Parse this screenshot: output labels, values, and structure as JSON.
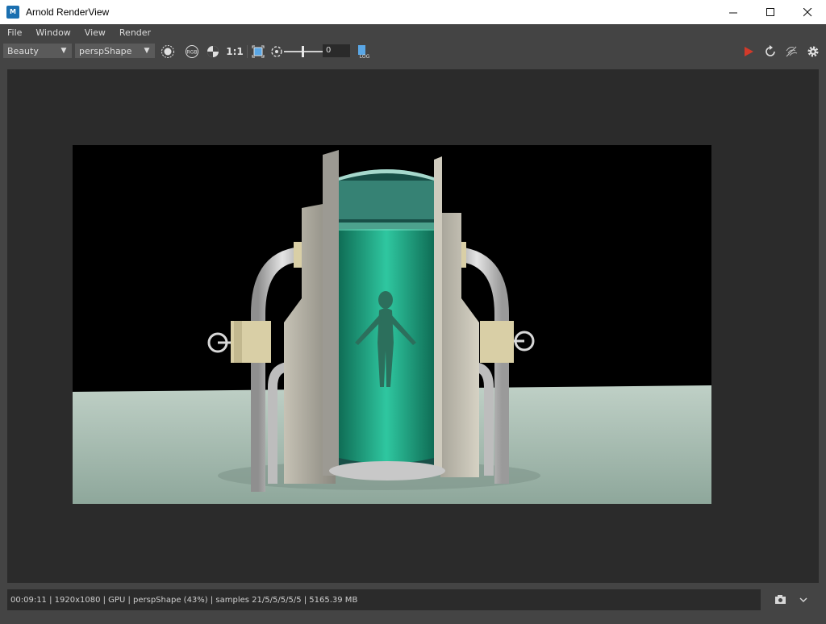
{
  "window": {
    "title": "Arnold RenderView",
    "app_icon": "M",
    "controls": {
      "minimize": "—",
      "maximize": "☐",
      "close": "✕"
    }
  },
  "menu": {
    "items": [
      "File",
      "Window",
      "View",
      "Render"
    ]
  },
  "toolbar": {
    "aov_select": "Beauty",
    "camera_select": "perspShape",
    "ratio_label": "1:1",
    "exposure_value": "0",
    "log_label": "LOG",
    "icons": [
      "display-settings-icon",
      "rgb-icon",
      "checker-icon",
      "crop-region-icon",
      "exposure-icon",
      "log-icon",
      "render-play-icon",
      "refresh-icon",
      "ipr-stop-icon",
      "gear-icon"
    ]
  },
  "status": {
    "text": "00:09:11 |  1920x1080 | GPU | perspShape (43%) | samples 21/5/5/5/5/5 | 5165.39 MB"
  },
  "colors": {
    "ui_bg": "#444444",
    "viewport_bg": "#2b2b2b",
    "render_accent": "#d23a2a",
    "liquid": "#1f9a78"
  }
}
